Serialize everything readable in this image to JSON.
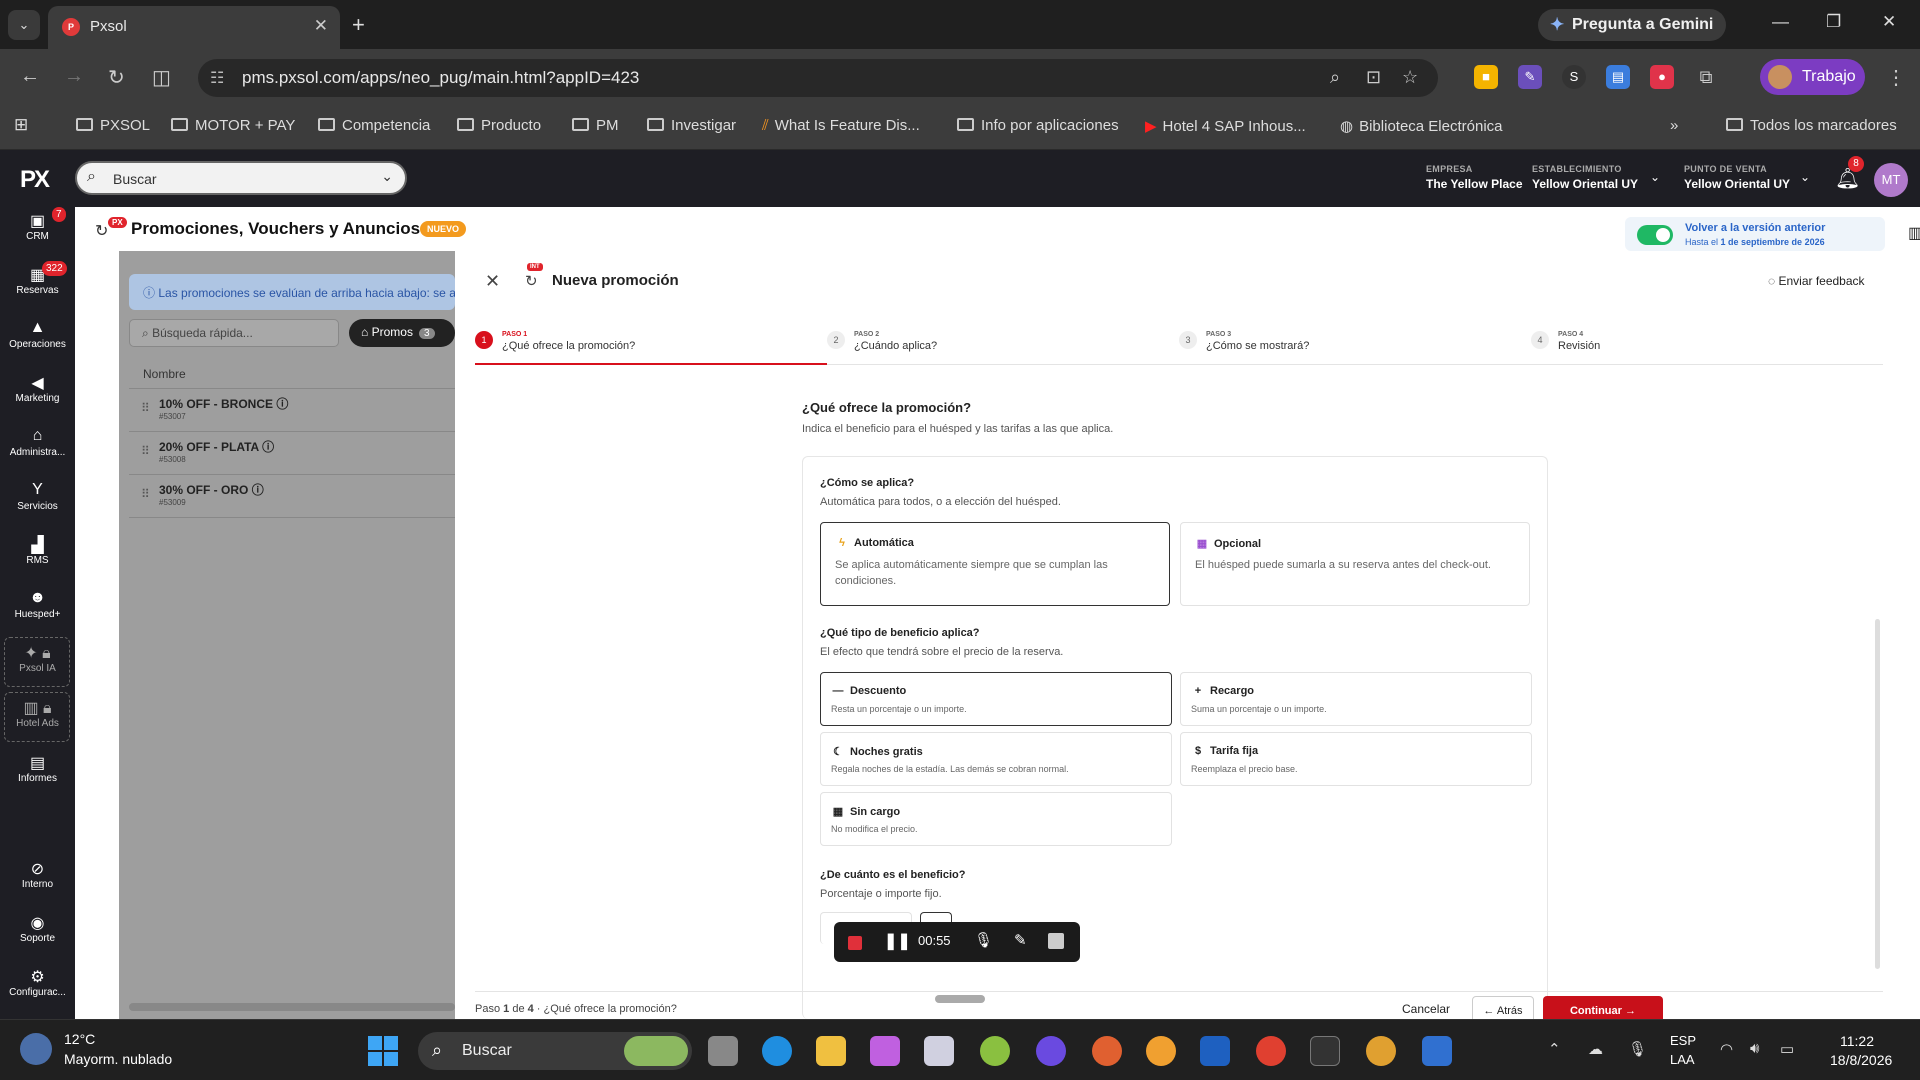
{
  "browser": {
    "tab_title": "Pxsol",
    "gemini_label": "Pregunta a Gemini",
    "url": "pms.pxsol.com/apps/neo_pug/main.html?appID=423",
    "profile_label": "Trabajo",
    "bookmarks": [
      "PXSOL",
      "MOTOR + PAY",
      "Competencia",
      "Producto",
      "PM",
      "Investigar",
      "What Is Feature Dis...",
      "Info por aplicaciones",
      "Hotel 4 SAP Inhous...",
      "Biblioteca Electrónica"
    ],
    "all_bookmarks": "Todos los marcadores"
  },
  "header": {
    "search_placeholder": "Buscar",
    "empresa_label": "EMPRESA",
    "empresa_value": "The Yellow Place",
    "establecimiento_label": "ESTABLECIMIENTO",
    "establecimiento_value": "Yellow Oriental UY",
    "punto_label": "PUNTO DE VENTA",
    "punto_value": "Yellow Oriental UY",
    "notif_count": "8",
    "avatar_initials": "MT"
  },
  "sidebar": {
    "items": [
      {
        "label": "CRM",
        "badge": "7"
      },
      {
        "label": "Reservas",
        "badge": "322"
      },
      {
        "label": "Operaciones"
      },
      {
        "label": "Marketing"
      },
      {
        "label": "Administra..."
      },
      {
        "label": "Servicios"
      },
      {
        "label": "RMS"
      },
      {
        "label": "Huesped+"
      },
      {
        "label": "Pxsol IA"
      },
      {
        "label": "Hotel Ads"
      },
      {
        "label": "Informes"
      },
      {
        "label": "Interno"
      },
      {
        "label": "Soporte"
      },
      {
        "label": "Configurac..."
      }
    ]
  },
  "page": {
    "px_badge": "PX",
    "title": "Promociones, Vouchers y Anuncios",
    "new_badge": "NUEVO",
    "version_title": "Volver a la versión anterior",
    "version_sub_prefix": "Hasta el ",
    "version_sub_date": "1 de septiembre de 2026",
    "info_banner": "Las promociones se evalúan de arriba hacia abajo: se ap",
    "quick_search_placeholder": "Búsqueda rápida...",
    "promos_label": "Promos",
    "promos_count": "3",
    "list_header": "Nombre",
    "promos": [
      {
        "name": "10% OFF - BRONCE",
        "id": "#53007"
      },
      {
        "name": "20% OFF - PLATA",
        "id": "#53008"
      },
      {
        "name": "30% OFF - ORO",
        "id": "#53009"
      }
    ]
  },
  "modal": {
    "int_badge": "INT",
    "title": "Nueva promoción",
    "feedback_label": "Enviar feedback",
    "steps": [
      {
        "num": "1",
        "paso": "PASO 1",
        "title": "¿Qué ofrece la promoción?"
      },
      {
        "num": "2",
        "paso": "PASO 2",
        "title": "¿Cuándo aplica?"
      },
      {
        "num": "3",
        "paso": "PASO 3",
        "title": "¿Cómo se mostrará?"
      },
      {
        "num": "4",
        "paso": "PASO 4",
        "title": "Revisión"
      }
    ],
    "question_title": "¿Qué ofrece la promoción?",
    "question_sub": "Indica el beneficio para el huésped y las tarifas a las que aplica.",
    "apply_title": "¿Cómo se aplica?",
    "apply_sub": "Automática para todos, o a elección del huésped.",
    "apply_options": [
      {
        "title": "Automática",
        "desc": "Se aplica automáticamente siempre que se cumplan las condiciones."
      },
      {
        "title": "Opcional",
        "desc": "El huésped puede sumarla a su reserva antes del check-out."
      }
    ],
    "benefit_title": "¿Qué tipo de beneficio aplica?",
    "benefit_sub": "El efecto que tendrá sobre el precio de la reserva.",
    "benefit_options": [
      {
        "title": "Descuento",
        "desc": "Resta un porcentaje o un importe."
      },
      {
        "title": "Recargo",
        "desc": "Suma un porcentaje o un importe."
      },
      {
        "title": "Noches gratis",
        "desc": "Regala noches de la estadía. Las demás se cobran normal."
      },
      {
        "title": "Tarifa fija",
        "desc": "Reemplaza el precio base."
      },
      {
        "title": "Sin cargo",
        "desc": "No modifica el precio."
      }
    ],
    "amount_title": "¿De cuánto es el beneficio?",
    "amount_sub": "Porcentaje o importe fijo.",
    "footer_prefix": "Paso ",
    "footer_current": "1",
    "footer_of": " de ",
    "footer_total": "4",
    "footer_suffix": " · ¿Qué ofrece la promoción?",
    "cancel": "Cancelar",
    "back": "Atrás",
    "continue": "Continuar"
  },
  "recorder": {
    "time": "00:55"
  },
  "taskbar": {
    "temp": "12°C",
    "weather": "Mayorm. nublado",
    "search": "Buscar",
    "lang1": "ESP",
    "lang2": "LAA",
    "time": "11:22",
    "date": "18/8/2026"
  }
}
